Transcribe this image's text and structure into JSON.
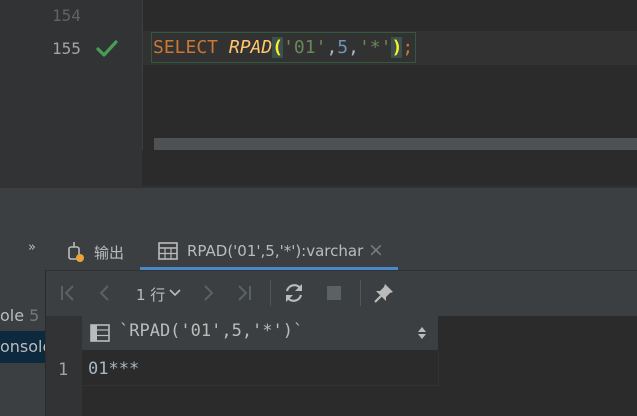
{
  "editor": {
    "lines": [
      {
        "number": "154",
        "active": false
      },
      {
        "number": "155",
        "active": true,
        "status_icon": "check-icon"
      }
    ],
    "code": {
      "keyword": "SELECT",
      "function": "RPAD",
      "open_paren": "(",
      "arg1": "'01'",
      "comma1": ",",
      "arg2": "5",
      "comma2": ",",
      "arg3": "'*'",
      "close_paren": ")",
      "terminator": ";"
    }
  },
  "tool_window": {
    "more_tabs_glyph": "»",
    "tabs": [
      {
        "label": "输出",
        "icon": "output-icon",
        "active": false
      },
      {
        "label": "RPAD('01',5,'*'):varchar",
        "icon": "table-icon",
        "active": true,
        "closable": true
      }
    ],
    "close_glyph": "×",
    "services": {
      "item1_label": "ole",
      "item1_suffix": "5",
      "item2_label": "onsole"
    },
    "toolbar": {
      "first_page": "first-page-icon",
      "prev_page": "previous-page-icon",
      "row_count": "1 行",
      "row_count_dropdown": "chevron-down-icon",
      "next_page": "next-page-icon",
      "last_page": "last-page-icon",
      "refresh": "refresh-icon",
      "stop": "stop-icon",
      "pin": "pin-icon"
    },
    "grid": {
      "column_header": "`RPAD('01',5,'*')`",
      "rows": [
        {
          "row_number": "1",
          "value": "01***"
        }
      ]
    }
  },
  "colors": {
    "keyword": "#cc7832",
    "function": "#ffc66d",
    "string": "#6a8759",
    "number": "#6897bb",
    "check": "#499c54",
    "accent": "#4a88c7"
  }
}
